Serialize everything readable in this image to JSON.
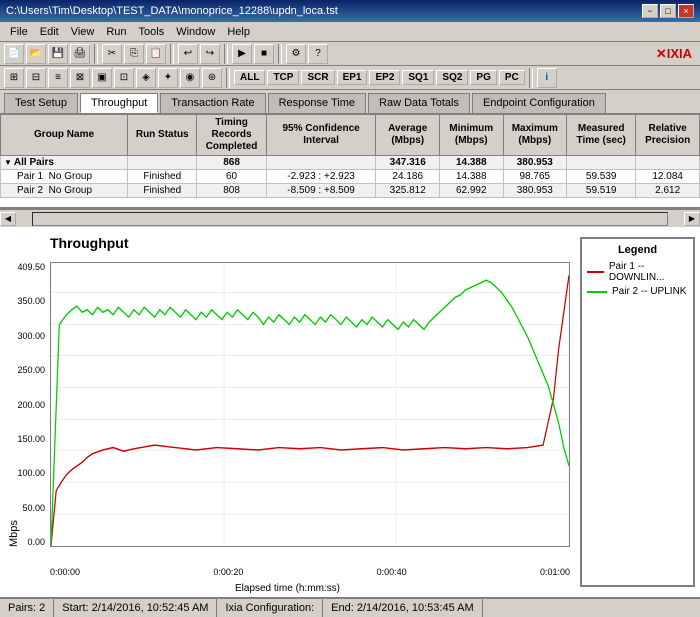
{
  "window": {
    "title": "C:\\Users\\Tim\\Desktop\\TEST_DATA\\monoprice_12288\\updn_loca.tst",
    "minimize_label": "−",
    "maximize_label": "□",
    "close_label": "×"
  },
  "menubar": {
    "items": [
      "File",
      "Edit",
      "View",
      "Run",
      "Tools",
      "Window",
      "Help"
    ]
  },
  "toolbar2_badges": [
    "ALL",
    "TCP",
    "SCR",
    "EP1",
    "EP2",
    "SQ1",
    "SQ2",
    "PG",
    "PC"
  ],
  "tabs": {
    "items": [
      "Test Setup",
      "Throughput",
      "Transaction Rate",
      "Response Time",
      "Raw Data Totals",
      "Endpoint Configuration"
    ],
    "active": 1
  },
  "table": {
    "headers": [
      "Group Name",
      "Run Status",
      "Timing Records Completed",
      "95% Confidence Interval",
      "Average (Mbps)",
      "Minimum (Mbps)",
      "Maximum (Mbps)",
      "Measured Time (sec)",
      "Relative Precision"
    ],
    "rows": [
      {
        "name": "All Pairs",
        "type": "all",
        "indent": 0,
        "run_status": "",
        "records": "868",
        "confidence": "",
        "average": "347.316",
        "minimum": "14.388",
        "maximum": "380.953",
        "measured_time": "",
        "precision": ""
      },
      {
        "name": "Pair 1  No Group",
        "type": "pair",
        "indent": 1,
        "run_status": "Finished",
        "records": "60",
        "confidence": "-2.923 : +2.923",
        "average": "24.186",
        "minimum": "14.388",
        "maximum": "98.765",
        "measured_time": "59.539",
        "precision": "12.084"
      },
      {
        "name": "Pair 2  No Group",
        "type": "pair",
        "indent": 1,
        "run_status": "Finished",
        "records": "808",
        "confidence": "-8.509 : +8.509",
        "average": "325.812",
        "minimum": "62.992",
        "maximum": "380.953",
        "measured_time": "59.519",
        "precision": "2.612"
      }
    ]
  },
  "chart": {
    "title": "Throughput",
    "y_label": "Mbps",
    "x_label": "Elapsed time (h:mm:ss)",
    "y_ticks": [
      "0.00",
      "50.00",
      "100.00",
      "150.00",
      "200.00",
      "250.00",
      "300.00",
      "350.00",
      "409.50"
    ],
    "x_ticks": [
      "0:00:00",
      "0:00:20",
      "0:00:40",
      "0:01:00"
    ]
  },
  "legend": {
    "title": "Legend",
    "items": [
      {
        "label": "Pair 1 -- DOWNLIN...",
        "color": "#ff0000"
      },
      {
        "label": "Pair 2 -- UPLINK",
        "color": "#00cc00"
      }
    ]
  },
  "statusbar": {
    "pairs": "Pairs: 2",
    "start": "Start: 2/14/2016, 10:52:45 AM",
    "ixia": "Ixia Configuration:",
    "end": "End: 2/14/2016, 10:53:45 AM"
  }
}
